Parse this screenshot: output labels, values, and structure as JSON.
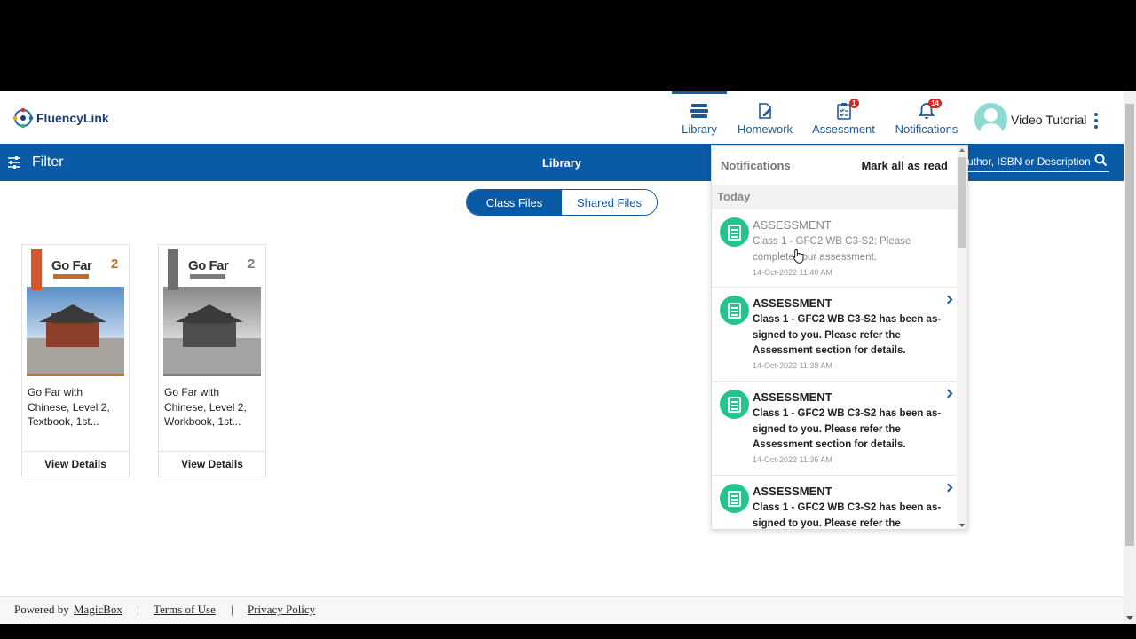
{
  "app": {
    "name": "FluencyLink"
  },
  "nav": [
    {
      "label": "Library",
      "icon": "library-icon",
      "badge": null
    },
    {
      "label": "Homework",
      "icon": "homework-icon",
      "badge": null
    },
    {
      "label": "Assessment",
      "icon": "assessment-icon",
      "badge": "1"
    },
    {
      "label": "Notifications",
      "icon": "bell-icon",
      "badge": "14"
    }
  ],
  "user": {
    "video_tutorial": "Video Tutorial"
  },
  "bar": {
    "filter_label": "Filter",
    "title": "Library",
    "search_placeholder": "uthor, ISBN or Description"
  },
  "toggle": {
    "class_files": "Class Files",
    "shared_files": "Shared Files",
    "selected": "Class Files"
  },
  "books": [
    {
      "title": "Go Far with Chinese, Level 2, Textbook, 1st...",
      "cover_title": "Go Far",
      "cover_level": "2",
      "action": "View Details"
    },
    {
      "title": "Go Far with Chinese, Level 2, Workbook, 1st...",
      "cover_title": "Go Far",
      "cover_level": "2",
      "action": "View Details"
    }
  ],
  "notifications": {
    "title": "Notifications",
    "mark_all": "Mark all as read",
    "group": "Today",
    "items": [
      {
        "type": "ASSESSMENT",
        "body": "Class 1 - GFC2 WB C3-S2: Please complete your assessment.",
        "time": "14-Oct-2022 11:40 AM",
        "read": true
      },
      {
        "type": "ASSESSMENT",
        "body": "Class 1 - GFC2 WB C3-S2 has been as-signed to you. Please refer the Assessment section for details.",
        "time": "14-Oct-2022 11:38 AM",
        "read": false
      },
      {
        "type": "ASSESSMENT",
        "body": "Class 1 - GFC2 WB C3-S2 has been as-signed to you. Please refer the Assessment section for details.",
        "time": "14-Oct-2022 11:36 AM",
        "read": false
      },
      {
        "type": "ASSESSMENT",
        "body": "Class 1 - GFC2 WB C3-S2 has been as-signed to you. Please refer the",
        "time": "",
        "read": false
      }
    ]
  },
  "footer": {
    "powered_by": "Powered by",
    "magicbox": "MagicBox",
    "sep": "|",
    "terms": "Terms of Use",
    "privacy": "Privacy Policy"
  },
  "colors": {
    "brand_blue": "#0b5aa6",
    "nav_blue": "#1f5a96",
    "badge_red": "#d7261c",
    "notif_green": "#23c48e"
  }
}
